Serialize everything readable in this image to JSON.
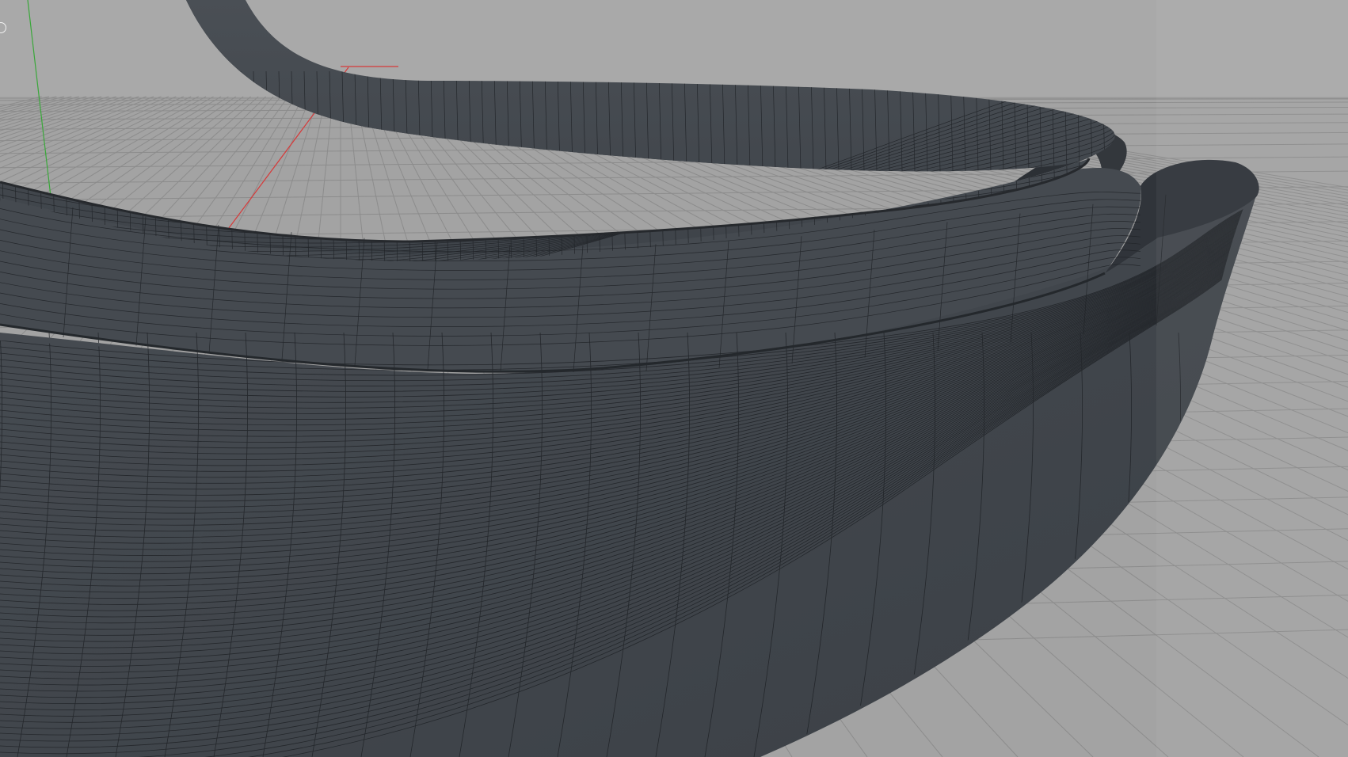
{
  "viewport": {
    "background_color": "#a5a5a5",
    "sky_color": "#a9a9a9",
    "floor_color": "#a3a3a3",
    "grid_line_color": "#8c8c8c",
    "grid_major_color": "#7a7a7a",
    "x_axis_color": "#d63a3a",
    "y_axis_color": "#3aa83a",
    "mesh_fill_color": "#42474d",
    "mesh_dark_color": "#2a2d31",
    "mesh_wire_color": "#1f2226",
    "panel_tint_color": "#b5b5b5",
    "view_handle_icon": "circle-outline-icon"
  }
}
